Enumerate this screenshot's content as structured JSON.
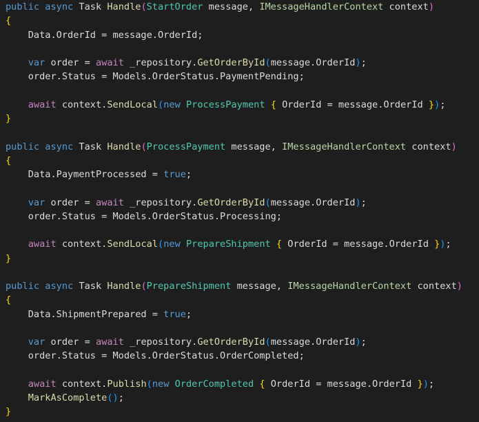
{
  "colors": {
    "background": "#1e1e1e",
    "default": "#dcdcdc",
    "keyword": "#569cd6",
    "control": "#c586c0",
    "type": "#4ec9b0",
    "interface": "#b8d7a3",
    "method": "#dcdcaa",
    "brace": "#ffd700",
    "paren": "#da70d6",
    "paren2": "#179fff"
  },
  "lines": [
    [
      {
        "t": "public",
        "c": "keyword"
      },
      {
        "t": " ",
        "c": "default"
      },
      {
        "t": "async",
        "c": "keyword"
      },
      {
        "t": " Task ",
        "c": "default"
      },
      {
        "t": "Handle",
        "c": "method"
      },
      {
        "t": "(",
        "c": "paren"
      },
      {
        "t": "StartOrder",
        "c": "type"
      },
      {
        "t": " message, ",
        "c": "default"
      },
      {
        "t": "IMessageHandlerContext",
        "c": "interface"
      },
      {
        "t": " context",
        "c": "default"
      },
      {
        "t": ")",
        "c": "paren"
      }
    ],
    [
      {
        "t": "{",
        "c": "brace"
      }
    ],
    [
      {
        "t": "    Data.OrderId = message.OrderId;",
        "c": "default"
      }
    ],
    [],
    [
      {
        "t": "    ",
        "c": "default"
      },
      {
        "t": "var",
        "c": "keyword"
      },
      {
        "t": " order = ",
        "c": "default"
      },
      {
        "t": "await",
        "c": "control"
      },
      {
        "t": " _repository.",
        "c": "default"
      },
      {
        "t": "GetOrderById",
        "c": "method"
      },
      {
        "t": "(",
        "c": "paren2"
      },
      {
        "t": "message.OrderId",
        "c": "default"
      },
      {
        "t": ")",
        "c": "paren2"
      },
      {
        "t": ";",
        "c": "default"
      }
    ],
    [
      {
        "t": "    order.Status = Models.OrderStatus.PaymentPending;",
        "c": "default"
      }
    ],
    [],
    [
      {
        "t": "    ",
        "c": "default"
      },
      {
        "t": "await",
        "c": "control"
      },
      {
        "t": " context.",
        "c": "default"
      },
      {
        "t": "SendLocal",
        "c": "method"
      },
      {
        "t": "(",
        "c": "paren2"
      },
      {
        "t": "new",
        "c": "keyword"
      },
      {
        "t": " ",
        "c": "default"
      },
      {
        "t": "ProcessPayment",
        "c": "type"
      },
      {
        "t": " ",
        "c": "default"
      },
      {
        "t": "{",
        "c": "brace"
      },
      {
        "t": " OrderId = message.OrderId ",
        "c": "default"
      },
      {
        "t": "}",
        "c": "brace"
      },
      {
        "t": ")",
        "c": "paren2"
      },
      {
        "t": ";",
        "c": "default"
      }
    ],
    [
      {
        "t": "}",
        "c": "brace"
      }
    ],
    [],
    [
      {
        "t": "public",
        "c": "keyword"
      },
      {
        "t": " ",
        "c": "default"
      },
      {
        "t": "async",
        "c": "keyword"
      },
      {
        "t": " Task ",
        "c": "default"
      },
      {
        "t": "Handle",
        "c": "method"
      },
      {
        "t": "(",
        "c": "paren"
      },
      {
        "t": "ProcessPayment",
        "c": "type"
      },
      {
        "t": " message, ",
        "c": "default"
      },
      {
        "t": "IMessageHandlerContext",
        "c": "interface"
      },
      {
        "t": " context",
        "c": "default"
      },
      {
        "t": ")",
        "c": "paren"
      }
    ],
    [
      {
        "t": "{",
        "c": "brace"
      }
    ],
    [
      {
        "t": "    Data.PaymentProcessed = ",
        "c": "default"
      },
      {
        "t": "true",
        "c": "keyword"
      },
      {
        "t": ";",
        "c": "default"
      }
    ],
    [],
    [
      {
        "t": "    ",
        "c": "default"
      },
      {
        "t": "var",
        "c": "keyword"
      },
      {
        "t": " order = ",
        "c": "default"
      },
      {
        "t": "await",
        "c": "control"
      },
      {
        "t": " _repository.",
        "c": "default"
      },
      {
        "t": "GetOrderById",
        "c": "method"
      },
      {
        "t": "(",
        "c": "paren2"
      },
      {
        "t": "message.OrderId",
        "c": "default"
      },
      {
        "t": ")",
        "c": "paren2"
      },
      {
        "t": ";",
        "c": "default"
      }
    ],
    [
      {
        "t": "    order.Status = Models.OrderStatus.Processing;",
        "c": "default"
      }
    ],
    [],
    [
      {
        "t": "    ",
        "c": "default"
      },
      {
        "t": "await",
        "c": "control"
      },
      {
        "t": " context.",
        "c": "default"
      },
      {
        "t": "SendLocal",
        "c": "method"
      },
      {
        "t": "(",
        "c": "paren2"
      },
      {
        "t": "new",
        "c": "keyword"
      },
      {
        "t": " ",
        "c": "default"
      },
      {
        "t": "PrepareShipment",
        "c": "type"
      },
      {
        "t": " ",
        "c": "default"
      },
      {
        "t": "{",
        "c": "brace"
      },
      {
        "t": " OrderId = message.OrderId ",
        "c": "default"
      },
      {
        "t": "}",
        "c": "brace"
      },
      {
        "t": ")",
        "c": "paren2"
      },
      {
        "t": ";",
        "c": "default"
      }
    ],
    [
      {
        "t": "}",
        "c": "brace"
      }
    ],
    [],
    [
      {
        "t": "public",
        "c": "keyword"
      },
      {
        "t": " ",
        "c": "default"
      },
      {
        "t": "async",
        "c": "keyword"
      },
      {
        "t": " Task ",
        "c": "default"
      },
      {
        "t": "Handle",
        "c": "method"
      },
      {
        "t": "(",
        "c": "paren"
      },
      {
        "t": "PrepareShipment",
        "c": "type"
      },
      {
        "t": " message, ",
        "c": "default"
      },
      {
        "t": "IMessageHandlerContext",
        "c": "interface"
      },
      {
        "t": " context",
        "c": "default"
      },
      {
        "t": ")",
        "c": "paren"
      }
    ],
    [
      {
        "t": "{",
        "c": "brace"
      }
    ],
    [
      {
        "t": "    Data.ShipmentPrepared = ",
        "c": "default"
      },
      {
        "t": "true",
        "c": "keyword"
      },
      {
        "t": ";",
        "c": "default"
      }
    ],
    [],
    [
      {
        "t": "    ",
        "c": "default"
      },
      {
        "t": "var",
        "c": "keyword"
      },
      {
        "t": " order = ",
        "c": "default"
      },
      {
        "t": "await",
        "c": "control"
      },
      {
        "t": " _repository.",
        "c": "default"
      },
      {
        "t": "GetOrderById",
        "c": "method"
      },
      {
        "t": "(",
        "c": "paren2"
      },
      {
        "t": "message.OrderId",
        "c": "default"
      },
      {
        "t": ")",
        "c": "paren2"
      },
      {
        "t": ";",
        "c": "default"
      }
    ],
    [
      {
        "t": "    order.Status = Models.OrderStatus.OrderCompleted;",
        "c": "default"
      }
    ],
    [],
    [
      {
        "t": "    ",
        "c": "default"
      },
      {
        "t": "await",
        "c": "control"
      },
      {
        "t": " context.",
        "c": "default"
      },
      {
        "t": "Publish",
        "c": "method"
      },
      {
        "t": "(",
        "c": "paren2"
      },
      {
        "t": "new",
        "c": "keyword"
      },
      {
        "t": " ",
        "c": "default"
      },
      {
        "t": "OrderCompleted",
        "c": "type"
      },
      {
        "t": " ",
        "c": "default"
      },
      {
        "t": "{",
        "c": "brace"
      },
      {
        "t": " OrderId = message.OrderId ",
        "c": "default"
      },
      {
        "t": "}",
        "c": "brace"
      },
      {
        "t": ")",
        "c": "paren2"
      },
      {
        "t": ";",
        "c": "default"
      }
    ],
    [
      {
        "t": "    ",
        "c": "default"
      },
      {
        "t": "MarkAsComplete",
        "c": "method"
      },
      {
        "t": "()",
        "c": "paren2"
      },
      {
        "t": ";",
        "c": "default"
      }
    ],
    [
      {
        "t": "}",
        "c": "brace"
      }
    ]
  ]
}
